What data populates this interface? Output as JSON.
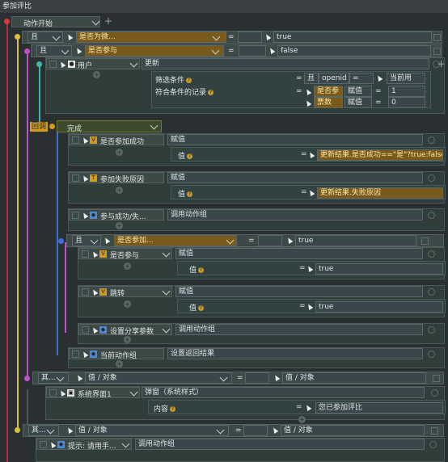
{
  "window": {
    "title": "参加评比"
  },
  "root": {
    "label": "动作开始"
  },
  "cond1": {
    "op": "且",
    "var": "是否为微...",
    "eq": "=",
    "val": "true"
  },
  "cond2": {
    "op": "且",
    "var": "是否参与",
    "eq": "=",
    "val": "false"
  },
  "user": {
    "label": "用户",
    "action": "更新",
    "filter_label": "筛选条件",
    "records_label": "符合条件的记录",
    "f_op": "且",
    "f_field": "openid",
    "f_eq": "=",
    "f_val": "当前用",
    "r1_field": "是否参",
    "r1_op": "赋值",
    "r1_eq": "=",
    "r1_val": "1",
    "r2_field": "票数",
    "r2_op": "赋值",
    "r2_eq": "=",
    "r2_val": "0"
  },
  "callback": {
    "tag": "回调",
    "label": "完成"
  },
  "steps": [
    {
      "label": "是否参加成功",
      "action": "赋值",
      "val_label": "值",
      "value": "更新结果.是否成功==\"是\"?true:false"
    },
    {
      "label": "参加失败原因",
      "action": "赋值",
      "val_label": "值",
      "value": "更新结果.失败原因"
    },
    {
      "label": "参与成功/失...",
      "action": "调用动作组"
    }
  ],
  "cond3": {
    "op": "且",
    "var": "是否参加...",
    "eq": "=",
    "val": "true"
  },
  "inner": [
    {
      "label": "是否参与",
      "action": "赋值",
      "val_label": "值",
      "value": "true"
    },
    {
      "label": "跳转",
      "action": "赋值",
      "val_label": "值",
      "value": "true"
    },
    {
      "label": "设置分享参数",
      "action": "调用动作组"
    }
  ],
  "current": {
    "label": "当前动作组",
    "action": "设置返回结果"
  },
  "else1": {
    "op": "其...",
    "left": "值 / 对象",
    "eq": "=",
    "right": "值 / 对象"
  },
  "sys": {
    "label": "系统界面1",
    "action": "弹窗（系统样式）",
    "content_label": "内容",
    "content_eq": "=",
    "content_value": "您已参加评比"
  },
  "else2": {
    "op": "其...",
    "left": "值 / 对象",
    "eq": "=",
    "right": "值 / 对象"
  },
  "tip": {
    "label": "提示: 请用手...",
    "action": "调用动作组"
  },
  "colors": {
    "accent": "#d39a22",
    "line_pink": "#c050c8",
    "line_teal": "#3fb8a8",
    "line_blue": "#3d6fd6",
    "line_red": "#e03838"
  }
}
